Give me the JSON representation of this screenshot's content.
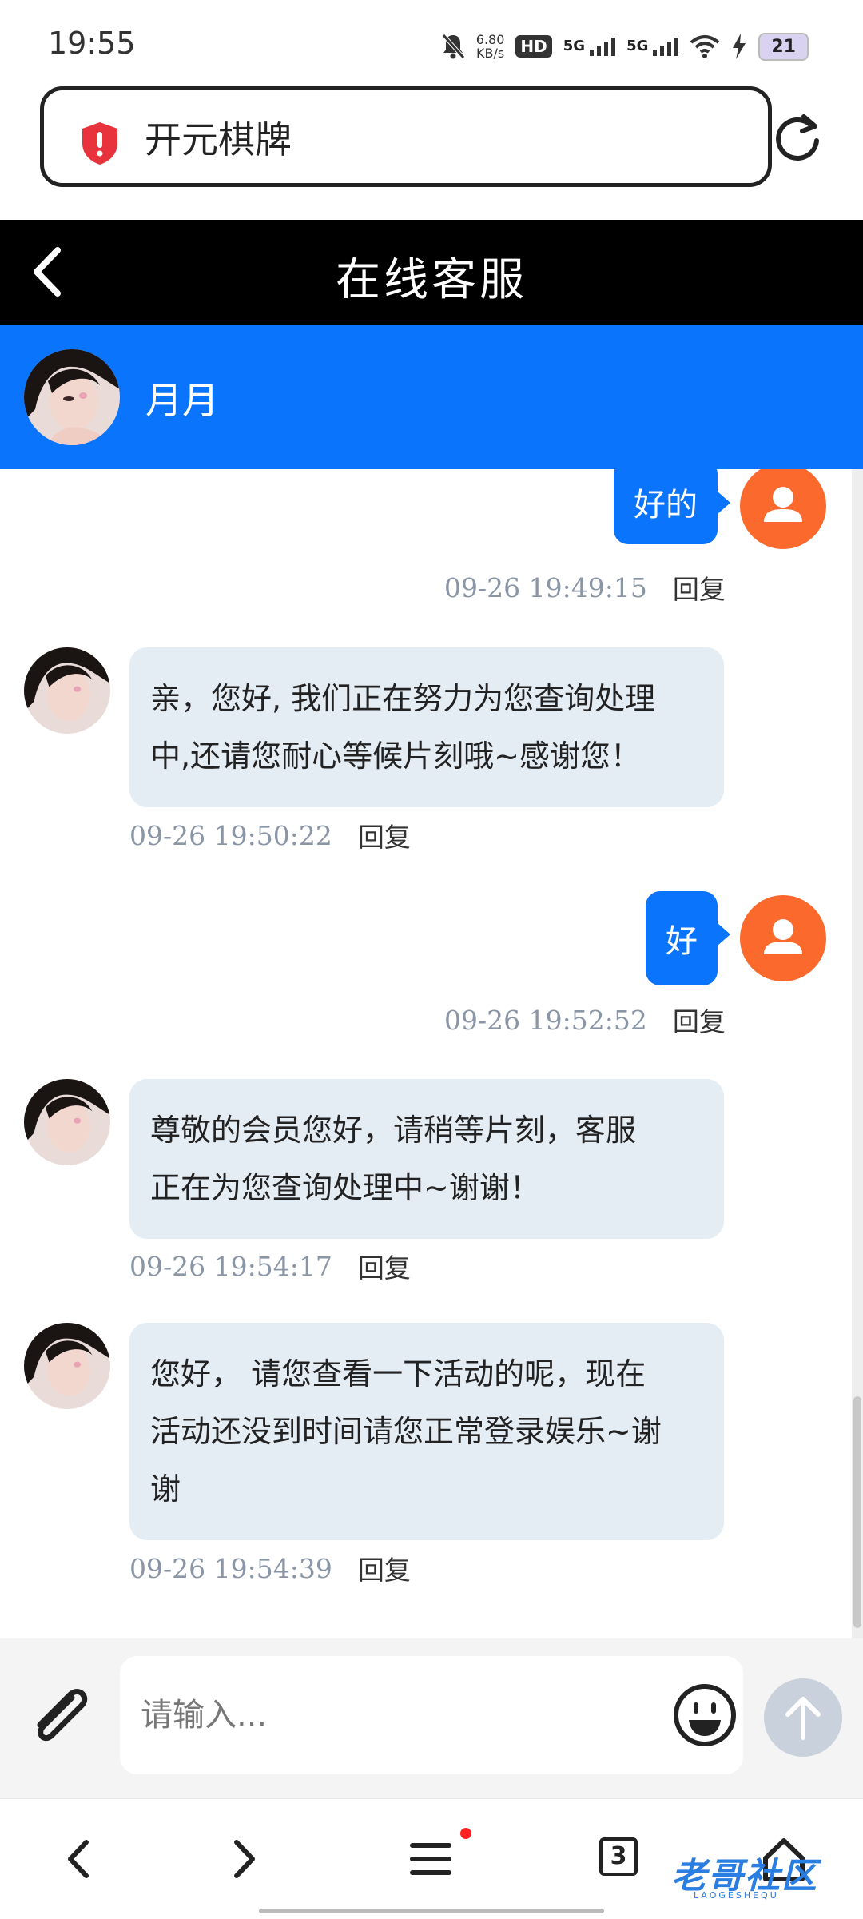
{
  "status_bar": {
    "time": "19:55",
    "net_speed_value": "6.80",
    "net_speed_unit": "KB/s",
    "hd_badge": "HD",
    "sim1_type": "5G",
    "sim2_type": "5G",
    "battery": "21"
  },
  "url_bar": {
    "title": "开元棋牌",
    "shield_icon": "shield-warning-icon"
  },
  "header": {
    "title": "在线客服"
  },
  "agent": {
    "name": "月月"
  },
  "messages": [
    {
      "side": "out",
      "text": "好的",
      "time": "09-26 19:49:15",
      "reply": "回复"
    },
    {
      "side": "in",
      "lines": [
        "亲，您好, 我们正在努力为您查询处理",
        "中,还请您耐心等候片刻哦~感谢您！"
      ],
      "time": "09-26 19:50:22",
      "reply": "回复"
    },
    {
      "side": "out",
      "text": "好",
      "time": "09-26 19:52:52",
      "reply": "回复"
    },
    {
      "side": "in",
      "lines": [
        "尊敬的会员您好，请稍等片刻，客服",
        "正在为您查询处理中~谢谢！"
      ],
      "time": "09-26 19:54:17",
      "reply": "回复"
    },
    {
      "side": "in",
      "lines": [
        "您好，  请您查看一下活动的呢，现在",
        "活动还没到时间请您正常登录娱乐~谢",
        "谢"
      ],
      "time": "09-26 19:54:39",
      "reply": "回复"
    }
  ],
  "input": {
    "placeholder": "请输入..."
  },
  "bottom_nav": {
    "tab_count": "3"
  },
  "watermark": {
    "text": "老哥社区",
    "sub": "LAOGESHEQU"
  },
  "colors": {
    "accent": "#0a74fc",
    "header_bg": "#000000",
    "user_avatar": "#fb6a2c",
    "incoming_bubble": "#e4ecf4"
  }
}
